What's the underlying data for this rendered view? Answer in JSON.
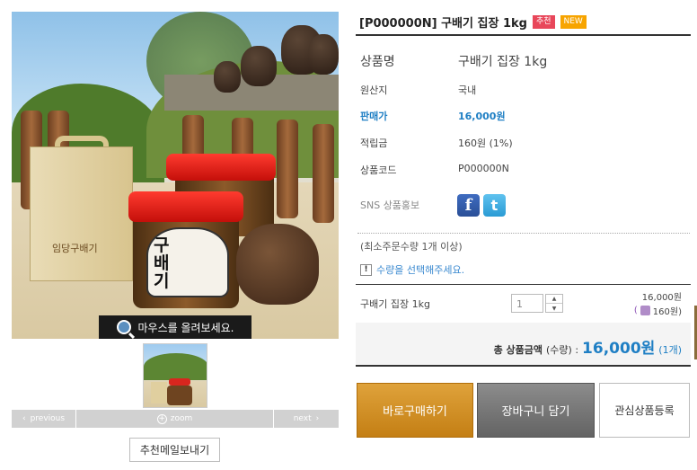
{
  "product": {
    "title": "[P000000N] 구배기 집장 1kg",
    "badges": [
      "추천",
      "NEW"
    ]
  },
  "image": {
    "zoom_hint": "마우스를 올려보세요.",
    "jar_label": "구배기",
    "box_text": "임당구배기"
  },
  "thumb_nav": {
    "prev": "previous",
    "zoom": "zoom",
    "next": "next"
  },
  "email_button": "추천메일보내기",
  "info": {
    "name_label": "상품명",
    "name_value": "구배기 집장 1kg",
    "origin_label": "원산지",
    "origin_value": "국내",
    "price_label": "판매가",
    "price_value": "16,000원",
    "point_label": "적립금",
    "point_value": "160원 (1%)",
    "code_label": "상품코드",
    "code_value": "P000000N",
    "sns_label": "SNS 상품홍보"
  },
  "order": {
    "min_order": "(최소주문수량 1개 이상)",
    "notice": "수량을 선택해주세요.",
    "option_name": "구배기 집장 1kg",
    "quantity": "1",
    "option_price": "16,000원",
    "option_point": "160원)"
  },
  "total": {
    "label": "총 상품금액",
    "qty_note": "(수량) :",
    "amount": "16,000원",
    "count": "(1개)"
  },
  "buttons": {
    "buy": "바로구매하기",
    "cart": "장바구니 담기",
    "wish": "관심상품등록"
  },
  "colors": {
    "accent_blue": "#1f7fc4",
    "buy_button": "#d2901f",
    "cart_button": "#767676",
    "badge_red": "#e8475a",
    "badge_orange": "#f7a400"
  }
}
